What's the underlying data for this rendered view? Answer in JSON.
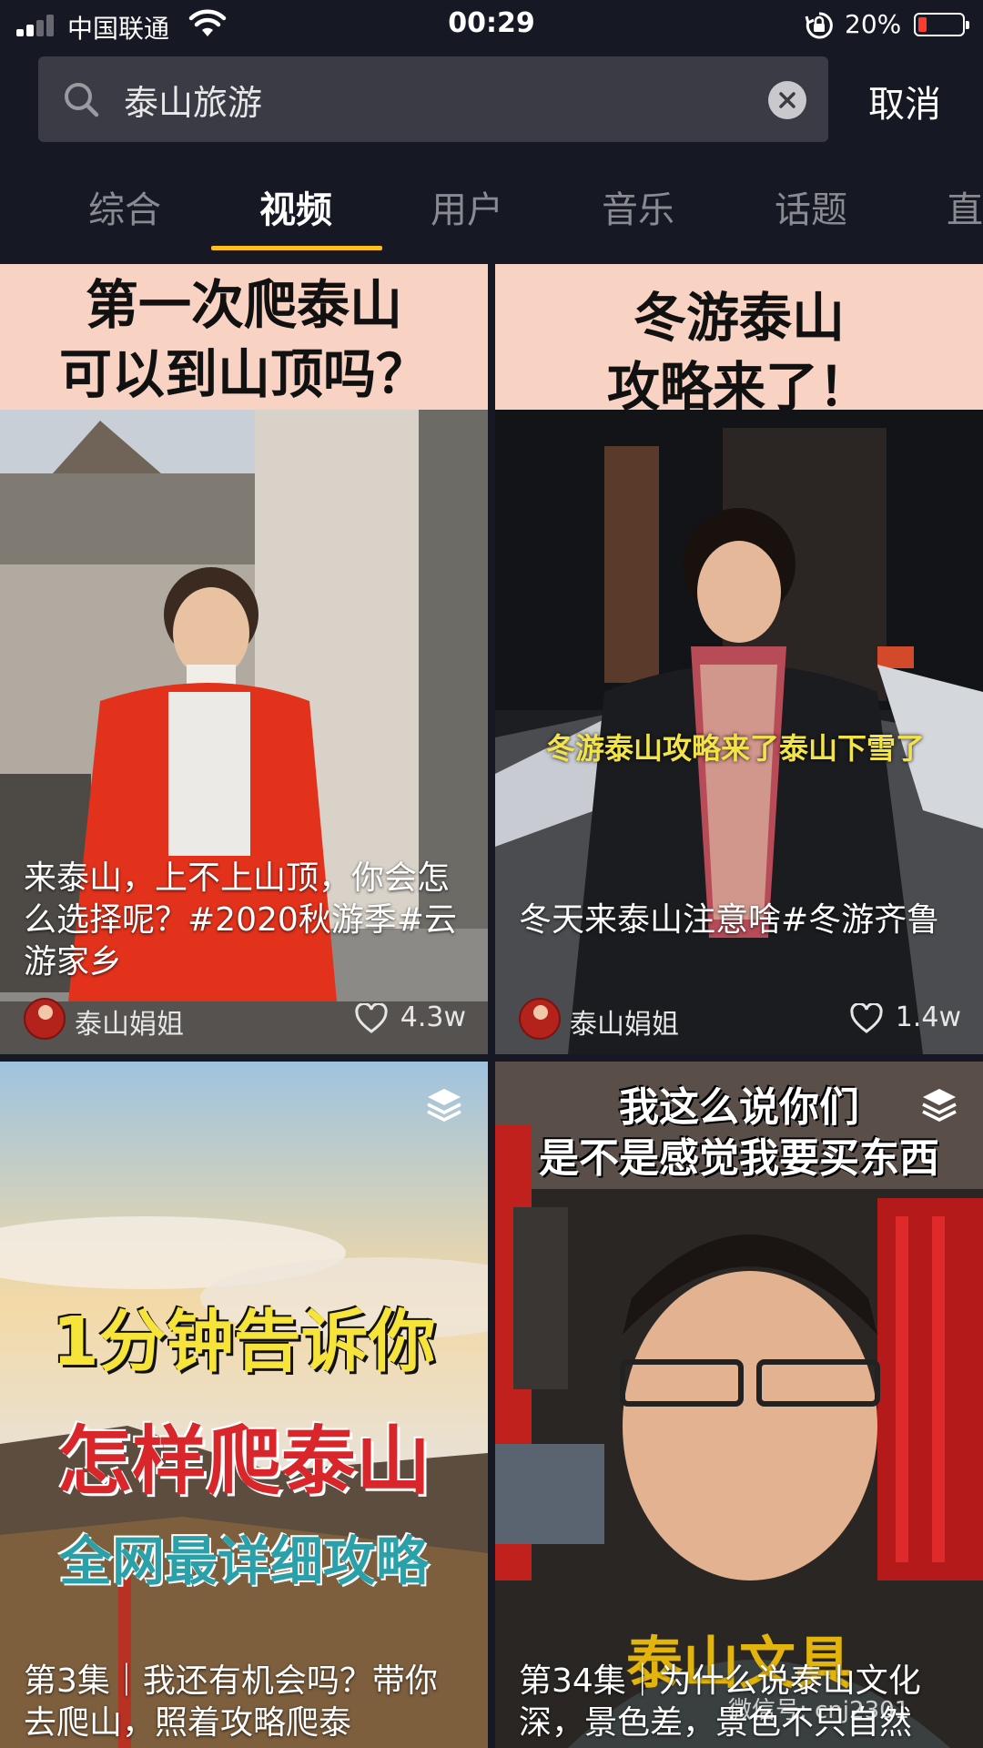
{
  "status_bar": {
    "carrier": "中国联通",
    "time": "00:29",
    "battery_percent": "20%",
    "battery_level": 0.2,
    "signal_bars": 2
  },
  "search": {
    "query": "泰山旅游",
    "cancel_label": "取消"
  },
  "tabs": [
    {
      "label": "综合",
      "active": false
    },
    {
      "label": "视频",
      "active": true
    },
    {
      "label": "用户",
      "active": false
    },
    {
      "label": "音乐",
      "active": false
    },
    {
      "label": "话题",
      "active": false
    },
    {
      "label": "直",
      "active": false
    }
  ],
  "colors": {
    "background": "#161823",
    "tab_underline": "#fac11b",
    "cover_band": "#f8d3c3",
    "battery_low": "#ff3b30"
  },
  "cards": [
    {
      "cover_title_1": "第一次爬泰山",
      "cover_title_2": "可以到山顶吗？",
      "caption": "来泰山，上不上山顶，你会怎么选择呢？#2020秋游季#云游家乡",
      "author": "泰山娟姐",
      "likes": "4.3w"
    },
    {
      "cover_title_1": "冬游泰山",
      "cover_title_2": "攻略来了！",
      "subtitle_sticker": "冬游泰山攻略来了泰山下雪了",
      "caption": "冬天来泰山注意啥#冬游齐鲁",
      "author": "泰山娟姐",
      "likes": "1.4w"
    },
    {
      "cover_line_1": "1分钟告诉你",
      "cover_line_2": "怎样爬泰山",
      "cover_line_3": "全网最详细攻略",
      "caption": "第3集｜我还有机会吗？带你去爬山，照着攻略爬泰",
      "is_collection": true
    },
    {
      "cover_title_1": "我这么说你们",
      "cover_title_2": "是不是感觉我要买东西",
      "bottom_sticker": "泰山文具",
      "caption": "第34集｜为什么说泰山文化深，景色差，景色不只自然",
      "is_collection": true,
      "watermark": "微信号: cnj2301"
    }
  ]
}
